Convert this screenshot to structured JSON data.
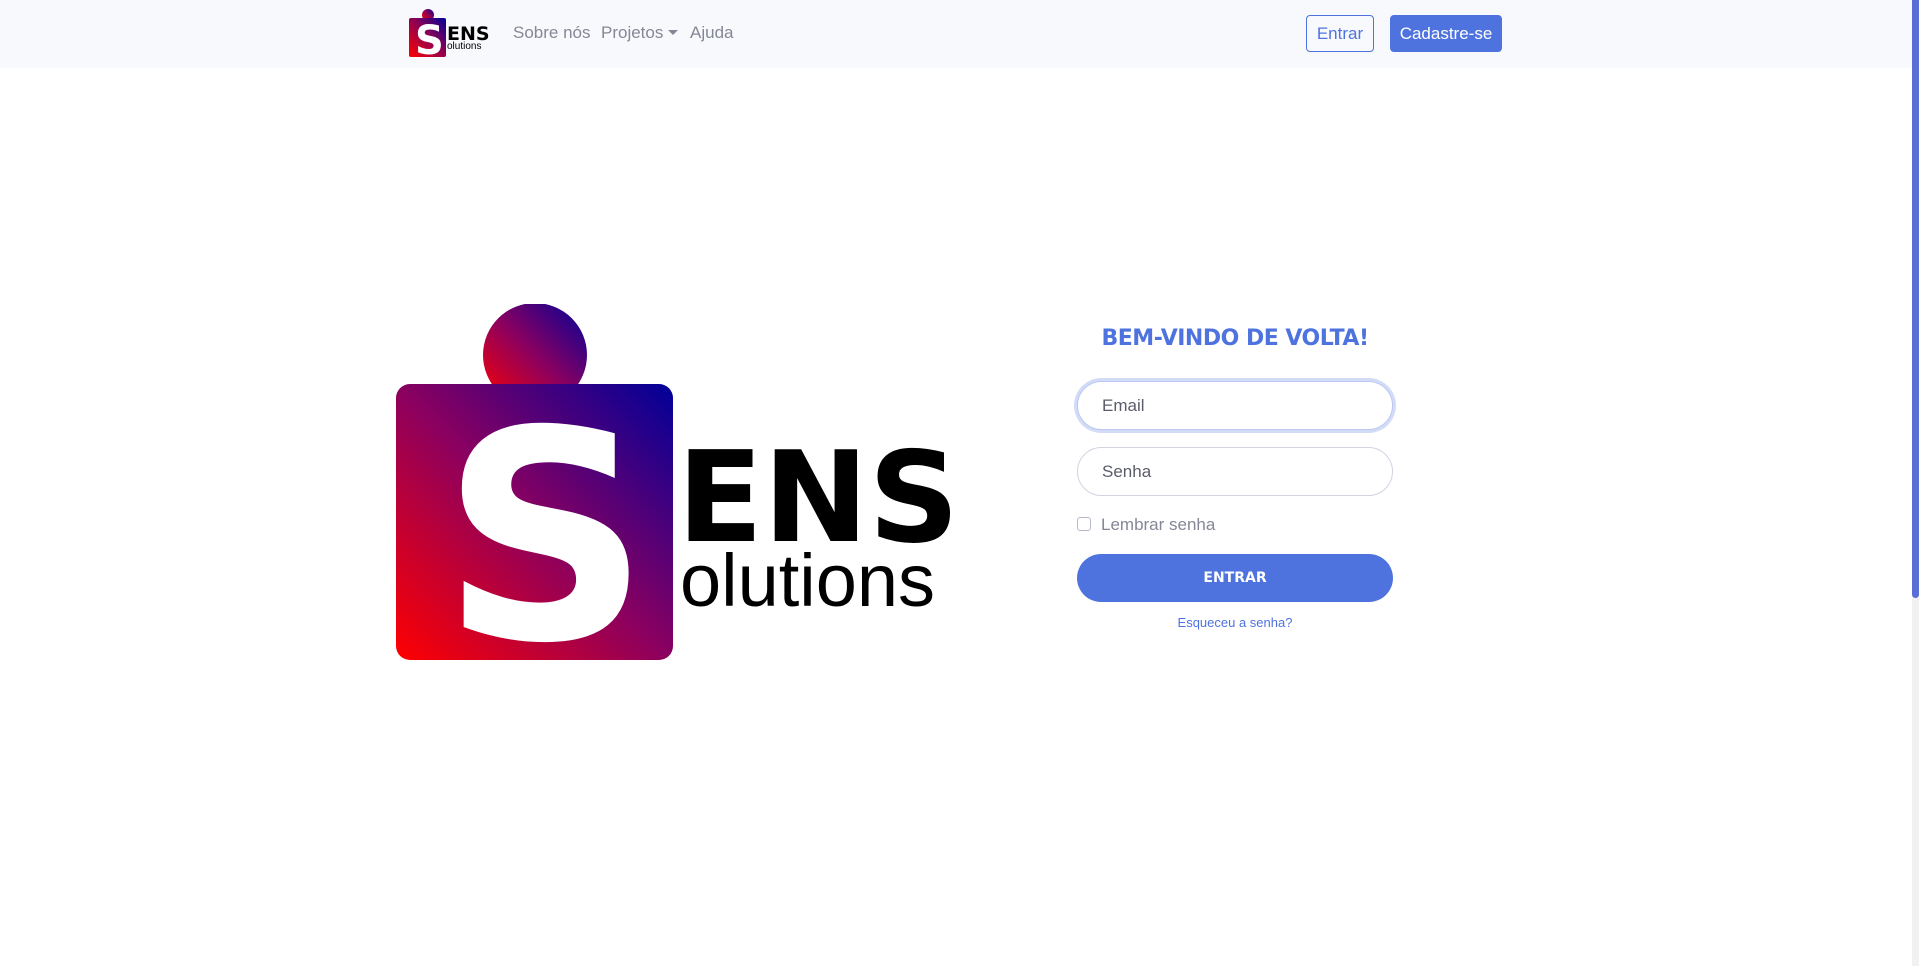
{
  "nav": {
    "logo_alt": "SENS Solutions",
    "links": [
      "Sobre nós",
      "Projetos",
      "Ajuda"
    ],
    "dropdown_icon": "caret-down-icon",
    "login_button": "Entrar",
    "signup_button": "Cadastre-se"
  },
  "logo": {
    "letter": "S",
    "word_top": "ENS",
    "word_bottom": "olutions"
  },
  "login": {
    "title": "BEM-VINDO DE VOLTA!",
    "email_placeholder": "Email",
    "password_placeholder": "Senha",
    "remember_label": "Lembrar senha",
    "submit_label": "ENTRAR",
    "forgot_link": "Esqueceu a senha?"
  },
  "colors": {
    "primary": "#4e73df",
    "gradient_red": "#ff0000",
    "gradient_blue": "#000099",
    "navbar_bg": "#f8f9fc"
  }
}
